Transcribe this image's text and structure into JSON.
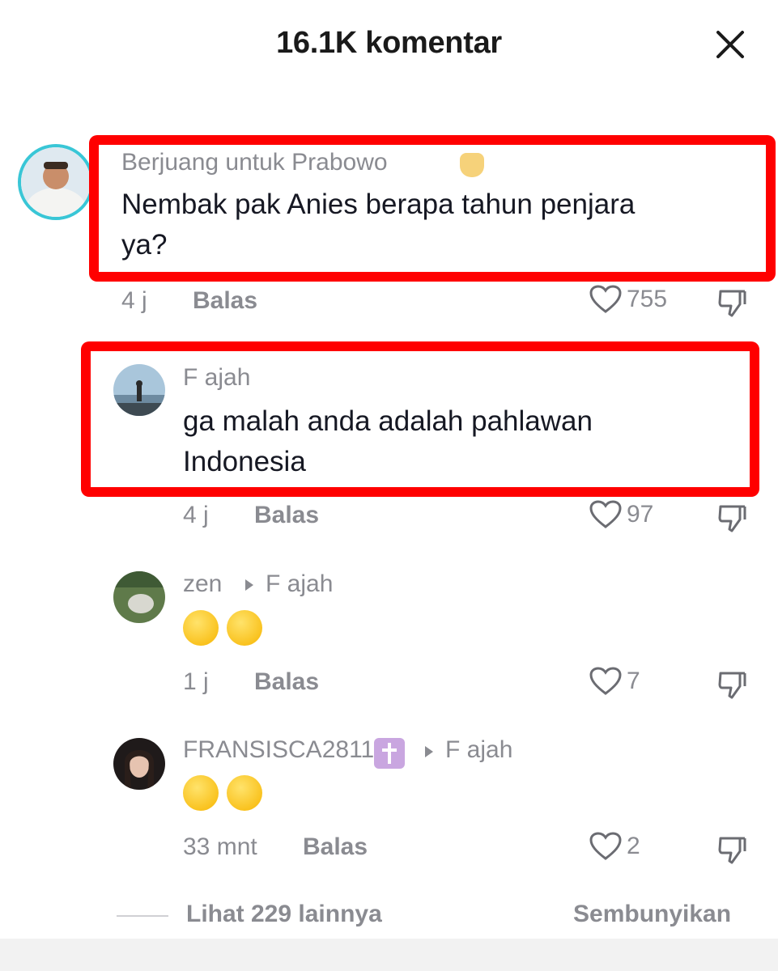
{
  "header": {
    "title": "16.1K komentar"
  },
  "comments": [
    {
      "username": "Berjuang untuk Prabowo",
      "text_line1": "Nembak pak Anies berapa tahun penjara",
      "text_line2": "ya?",
      "time": "4 j",
      "reply_label": "Balas",
      "likes": "755"
    },
    {
      "username": "F ajah",
      "text_line1": "ga malah anda adalah pahlawan",
      "text_line2": "Indonesia",
      "time": "4 j",
      "reply_label": "Balas",
      "likes": "97"
    },
    {
      "username": "zen",
      "reply_to": "F ajah",
      "emoji": "grinning-sweat-emoji x2",
      "time": "1 j",
      "reply_label": "Balas",
      "likes": "7"
    },
    {
      "username": "FRANSISCA2811",
      "reply_to": "F ajah",
      "emoji": "rolling-on-floor-laughing-emoji x2",
      "time": "33 mnt",
      "reply_label": "Balas",
      "likes": "2"
    }
  ],
  "footer": {
    "view_more": "Lihat 229 lainnya",
    "hide": "Sembunyikan"
  },
  "colors": {
    "highlight": "#ff0000",
    "muted_text": "#8a8b91",
    "avatar_ring": "#39c6d6"
  }
}
